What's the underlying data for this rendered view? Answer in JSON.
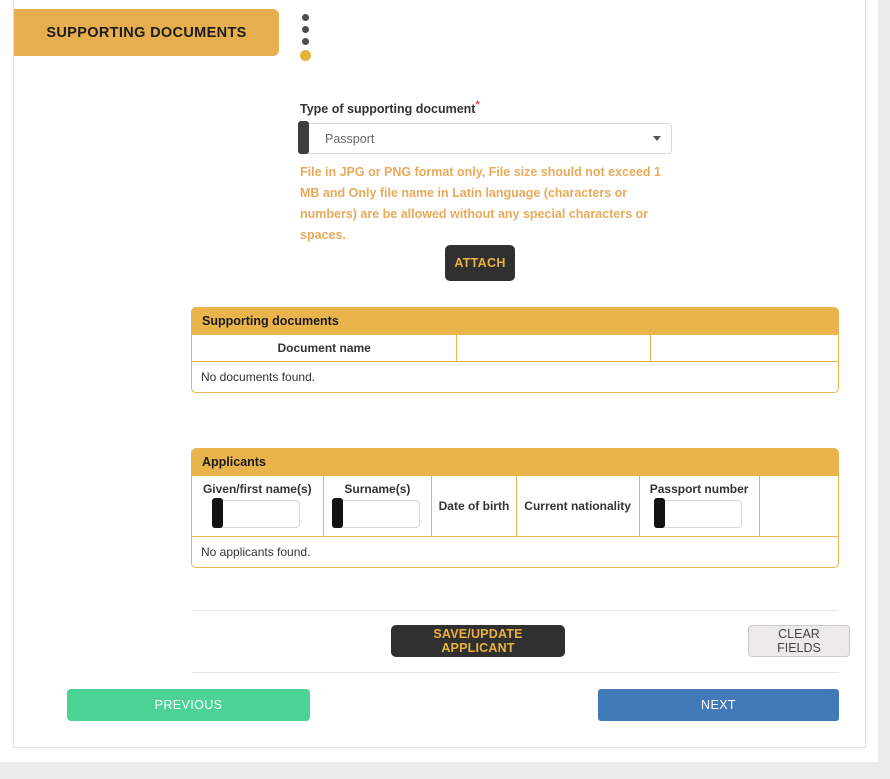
{
  "header": {
    "section_title": "SUPPORTING DOCUMENTS",
    "step_dots": [
      {
        "state": "inactive"
      },
      {
        "state": "inactive"
      },
      {
        "state": "inactive"
      },
      {
        "state": "active"
      }
    ]
  },
  "form": {
    "doc_type_label": "Type of supporting document",
    "doc_type_required_mark": "*",
    "doc_type_value": "Passport",
    "doc_type_options": [
      "Passport"
    ],
    "hint_text": "File in JPG or PNG format only, File size should not exceed 1 MB and Only file name in Latin language (characters or numbers) are be allowed without any special characters or spaces.",
    "attach_label": "ATTACH"
  },
  "documents_panel": {
    "title": "Supporting documents",
    "columns": [
      "Document name",
      "",
      ""
    ],
    "empty_message": "No documents found.",
    "rows": []
  },
  "applicants_panel": {
    "title": "Applicants",
    "columns": [
      {
        "label": "Given/first name(s)",
        "has_input": true,
        "value": "",
        "required": true
      },
      {
        "label": "Surname(s)",
        "has_input": true,
        "value": "",
        "required": true
      },
      {
        "label": "Date of birth",
        "has_input": false
      },
      {
        "label": "Current nationality",
        "has_input": false
      },
      {
        "label": "Passport number",
        "has_input": true,
        "value": "",
        "required": true
      },
      {
        "label": "",
        "has_input": false
      }
    ],
    "empty_message": "No applicants found.",
    "rows": []
  },
  "actions": {
    "save_applicant_label": "SAVE/UPDATE APPLICANT",
    "clear_fields_label": "CLEAR FIELDS",
    "previous_label": "PREVIOUS",
    "next_label": "NEXT"
  },
  "colors": {
    "accent_amber": "#e9b44c",
    "header_amber": "#e6ae4e",
    "hint_amber": "#e8aa5a",
    "dark_button": "#303030",
    "button_gold_text": "#e8b23c",
    "previous_green": "#4dd296",
    "next_blue": "#4279b8",
    "required_red": "#e04b4b",
    "page_background": "#ececec"
  }
}
